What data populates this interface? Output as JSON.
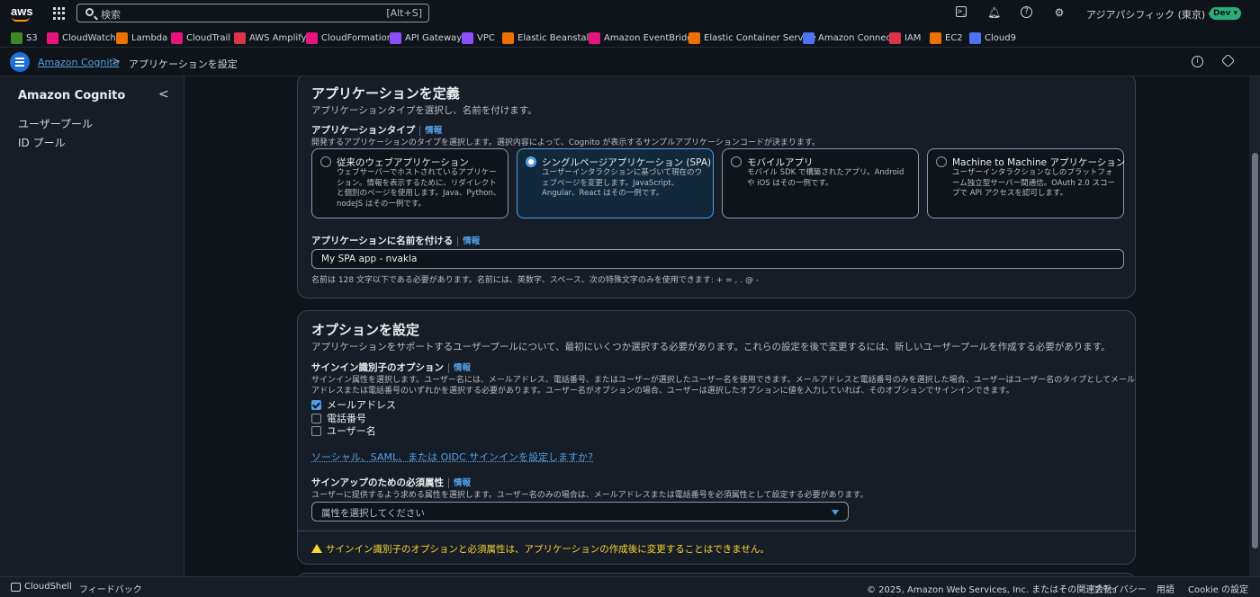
{
  "topnav": {
    "search_placeholder": "検索",
    "search_shortcut": "[Alt+S]",
    "region": "アジアパシフィック (東京) ▾",
    "account_badge": "Dev ▾"
  },
  "favorites": [
    {
      "label": "S3",
      "color": "#3f8624"
    },
    {
      "label": "CloudWatch",
      "color": "#e7157b"
    },
    {
      "label": "Lambda",
      "color": "#ed7100"
    },
    {
      "label": "CloudTrail",
      "color": "#e7157b"
    },
    {
      "label": "AWS Amplify",
      "color": "#dd344c"
    },
    {
      "label": "CloudFormation",
      "color": "#e7157b"
    },
    {
      "label": "API Gateway",
      "color": "#8c4fff"
    },
    {
      "label": "VPC",
      "color": "#8c4fff"
    },
    {
      "label": "Elastic Beanstalk",
      "color": "#ed7100"
    },
    {
      "label": "Amazon EventBridge",
      "color": "#e7157b"
    },
    {
      "label": "Elastic Container Service",
      "color": "#ed7100"
    },
    {
      "label": "Amazon Connect",
      "color": "#4d72f3"
    },
    {
      "label": "IAM",
      "color": "#dd344c"
    },
    {
      "label": "EC2",
      "color": "#ed7100"
    },
    {
      "label": "Cloud9",
      "color": "#4d72f3"
    }
  ],
  "breadcrumb": {
    "parent": "Amazon Cognito",
    "current": "アプリケーションを設定"
  },
  "sidebar": {
    "title": "Amazon Cognito",
    "items": [
      "ユーザープール",
      "ID プール"
    ]
  },
  "app_section": {
    "title": "アプリケーションを定義",
    "subtitle": "アプリケーションタイプを選択し、名前を付けます。",
    "type_label": "アプリケーションタイプ",
    "info": "情報",
    "type_desc": "開発するアプリケーションのタイプを選択します。選択内容によって、Cognito が表示するサンプルアプリケーションコードが決まります。",
    "tiles": [
      {
        "title": "従来のウェブアプリケーション",
        "desc": "ウェブサーバーでホストされているアプリケーション。情報を表示するために、リダイレクトと個別のページを使用します。Java、Python、nodeJS はその一例です。",
        "selected": false
      },
      {
        "title": "シングルページアプリケーション (SPA)",
        "desc": "ユーザーインタラクションに基づいて現在のウェブページを変更します。JavaScript、Angular、React はその一例です。",
        "selected": true
      },
      {
        "title": "モバイルアプリ",
        "desc": "モバイル SDK で構築されたアプリ。Android や iOS はその一例です。",
        "selected": false
      },
      {
        "title": "Machine to Machine アプリケーション",
        "desc": "ユーザーインタラクションなしのプラットフォーム独立型サーバー間通信。OAuth 2.0 スコープで API アクセスを認可します。",
        "selected": false
      }
    ],
    "name_label": "アプリケーションに名前を付ける",
    "name_value": "My SPA app - nvakla",
    "name_hint": "名前は 128 文字以下である必要があります。名前には、英数字、スペース、次の特殊文字のみを使用できます: + = , . @ -"
  },
  "options_section": {
    "title": "オプションを設定",
    "subtitle": "アプリケーションをサポートするユーザープールについて、最初にいくつか選択する必要があります。これらの設定を後で変更するには、新しいユーザープールを作成する必要があります。",
    "signin_label": "サインイン識別子のオプション",
    "info": "情報",
    "signin_desc_1": "サインイン属性を選択します。ユーザー名には、メールアドレス、電話番号、またはユーザーが選択したユーザー名を使用できます。メールアドレスと電話番号のみを選択した場合、ユーザーはユーザー名のタイプとしてメール",
    "signin_desc_2": "アドレスまたは電話番号のいずれかを選択する必要があります。ユーザー名がオプションの場合、ユーザーは選択したオプションに値を入力していれば、そのオプションでサインインできます。",
    "checkboxes": [
      {
        "label": "メールアドレス",
        "checked": true
      },
      {
        "label": "電話番号",
        "checked": false
      },
      {
        "label": "ユーザー名",
        "checked": false
      }
    ],
    "social_link": "ソーシャル、SAML、または OIDC サインインを設定しますか?",
    "signup_label": "サインアップのための必須属性",
    "signup_desc": "ユーザーに提供するよう求める属性を選択します。ユーザー名のみの場合は、メールアドレスまたは電話番号を必須属性として設定する必要があります。",
    "signup_placeholder": "属性を選択してください",
    "warning": "サインイン識別子のオプションと必須属性は、アプリケーションの作成後に変更することはできません。"
  },
  "footer": {
    "cloudshell": "CloudShell",
    "feedback": "フィードバック",
    "copyright": "© 2025, Amazon Web Services, Inc. またはその関連会社。",
    "privacy": "プライバシー",
    "terms": "用語",
    "cookie": "Cookie の設定"
  }
}
